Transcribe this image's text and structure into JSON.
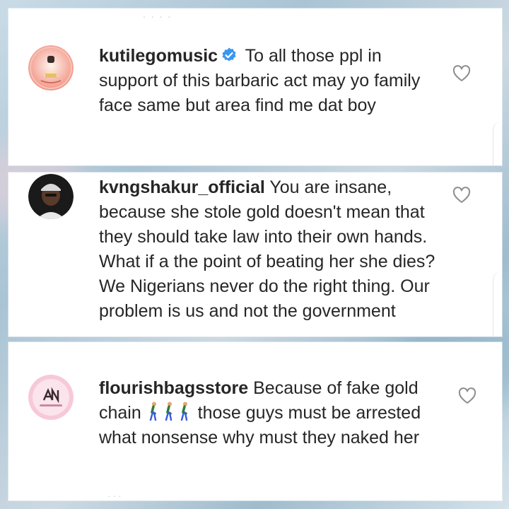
{
  "comments": [
    {
      "username": "kutilegomusic",
      "verified": true,
      "text": "To all those ppl in support of this barbaric act may yo family face same but area find me dat boy",
      "avatar_icon": "avatar-kutilegomusic"
    },
    {
      "username": "kvngshakur_official",
      "verified": false,
      "text": "You are insane, because she stole gold doesn't mean that they should take law into their own hands. What if a the point of beating her she dies? We Nigerians never do the right thing. Our problem is us and not the government",
      "avatar_icon": "avatar-kvngshakur"
    },
    {
      "username": "flourishbagsstore",
      "verified": false,
      "text_before": "Because of fake gold chain",
      "emoji": "person-walking-emoji",
      "emoji_count": 3,
      "text_after": "those guys must be arrested what nonsense why must they naked her",
      "avatar_icon": "avatar-flourishbagsstore"
    }
  ],
  "colors": {
    "text": "#262626",
    "verified_badge": "#3897f0",
    "heart_outline": "#8e8e8e",
    "background": "#b8cfdc"
  },
  "icons": [
    "verified-badge-icon",
    "heart-outline-icon",
    "person-walking-emoji"
  ]
}
